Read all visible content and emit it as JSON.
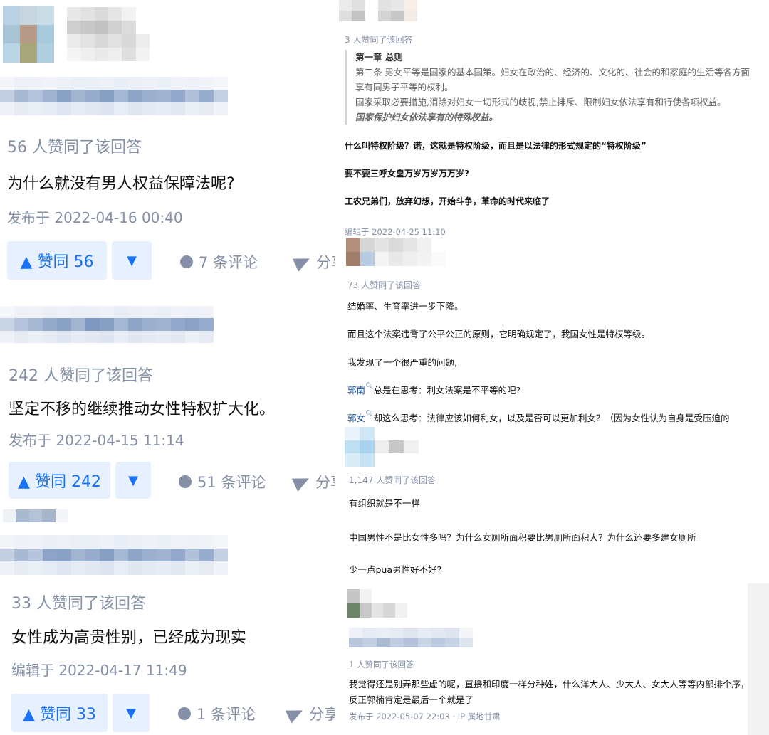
{
  "left_cards": [
    {
      "votes_text": "56 人赞同了该回答",
      "content": "为什么就没有男人权益保障法呢?",
      "time": "发布于 2022-04-16 00:40",
      "upvote_label": "▲ 赞同 56",
      "downvote_label": "▼",
      "comment_label": "7 条评论",
      "share_label": "分享"
    },
    {
      "votes_text": "242 人赞同了该回答",
      "content": "坚定不移的继续推动女性特权扩大化。",
      "time": "发布于 2022-04-15 11:14",
      "upvote_label": "▲ 赞同 242",
      "downvote_label": "▼",
      "comment_label": "51 条评论",
      "share_label": "分享"
    },
    {
      "votes_text": "33 人赞同了该回答",
      "content": "女性成为高贵性别，已经成为现实",
      "time": "编辑于 2022-04-17 11:49",
      "upvote_label": "▲ 赞同 33",
      "downvote_label": "▼",
      "comment_label": "1 条评论",
      "share_label": "分享"
    }
  ],
  "right": {
    "card1": {
      "votes_text": "3 人赞同了该回答",
      "quote_title": "第一章 总则",
      "quote_p1": "第二条 男女平等是国家的基本国策。妇女在政治的、经济的、文化的、社会的和家庭的生活等各方面享有同男子平等的权利。",
      "quote_p2": "国家采取必要措施,消除对妇女一切形式的歧视,禁止排斥、限制妇女依法享有和行使各项权益。",
      "quote_emph": "国家保护妇女依法享有的特殊权益。",
      "bold1": "什么叫特权阶级？诺，这就是特权阶级，而且是以法律的形式规定的“特权阶级”",
      "bold2": "要不要三呼女皇万岁万岁万万岁?",
      "bold3": "工农兄弟们，放弃幻想，开始斗争，革命的时代来临了",
      "time": "编辑于 2022-04-25 11:10"
    },
    "card2": {
      "votes_text": "73 人赞同了该回答",
      "line1": "结婚率、生育率进一步下降。",
      "line2": "而且这个法案违背了公平公正的原则，它明确规定了，我国女性是特权等级。",
      "line3": "我发现了一个很严重的问题,",
      "link1": "郭南",
      "line4": "总是在思考：利女法案是不平等的吧?",
      "link2": "郭女",
      "line5": "却这么思考：法律应该如何利女，以及是否可以更加利女？（因为女性认为自身是受压迫的"
    },
    "card3": {
      "votes_text": "1,147 人赞同了该回答",
      "line1": "有组织就是不一样",
      "line2": "中国男性不是比女性多吗？为什么女厕所面积要比男厕所面积大？为什么还要多建女厕所",
      "line3": "少一点pua男性好不好?"
    },
    "card4": {
      "votes_text": "1 人赞同了该回答",
      "line1": "我觉得还是别弄那些虚的呢，直接和印度一样分种姓，什么洋大人、少大人、女大人等等内部排个序，反正郭楠肯定是最后一个就是了",
      "time": "发布于 2022-05-07 22:03 · IP 属地甘肃"
    }
  },
  "colors": {
    "brand_blue": "#1772f6",
    "button_bg": "#e7f0ff",
    "meta_gray": "#8590a6",
    "link_blue": "#175199"
  },
  "icons": [
    "comment-icon",
    "share-icon",
    "search-link-icon"
  ]
}
